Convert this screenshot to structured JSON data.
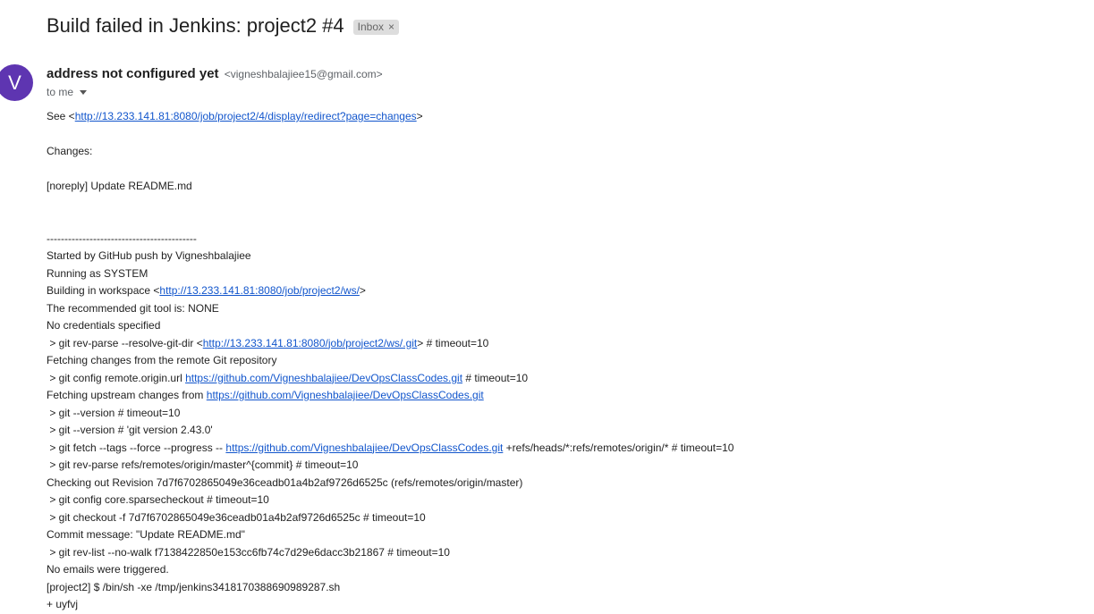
{
  "email": {
    "subject": "Build failed in Jenkins: project2 #4",
    "label": "Inbox",
    "label_close": "×",
    "avatar_letter": "V",
    "sender_name": "address not configured yet",
    "sender_email": "<vigneshbalajiee15@gmail.com>",
    "to": "to me"
  },
  "body_lines": [
    [
      {
        "t": "See <"
      },
      {
        "t": "http://13.233.141.81:8080/job/project2/4/display/redirect?page=changes",
        "link": true
      },
      {
        "t": ">"
      }
    ],
    [],
    [
      {
        "t": "Changes:"
      }
    ],
    [],
    [
      {
        "t": "[noreply] Update README.md"
      }
    ],
    [],
    [],
    [
      {
        "t": "------------------------------------------"
      }
    ],
    [
      {
        "t": "Started by GitHub push by Vigneshbalajiee"
      }
    ],
    [
      {
        "t": "Running as SYSTEM"
      }
    ],
    [
      {
        "t": "Building in workspace <"
      },
      {
        "t": "http://13.233.141.81:8080/job/project2/ws/",
        "link": true
      },
      {
        "t": ">"
      }
    ],
    [
      {
        "t": "The recommended git tool is: NONE"
      }
    ],
    [
      {
        "t": "No credentials specified"
      }
    ],
    [
      {
        "t": " > git rev-parse --resolve-git-dir <"
      },
      {
        "t": "http://13.233.141.81:8080/job/project2/ws/.git",
        "link": true
      },
      {
        "t": "> # timeout=10"
      }
    ],
    [
      {
        "t": "Fetching changes from the remote Git repository"
      }
    ],
    [
      {
        "t": " > git config remote.origin.url "
      },
      {
        "t": "https://github.com/Vigneshbalajiee/DevOpsClassCodes.git",
        "link": true
      },
      {
        "t": " # timeout=10"
      }
    ],
    [
      {
        "t": "Fetching upstream changes from "
      },
      {
        "t": "https://github.com/Vigneshbalajiee/DevOpsClassCodes.git",
        "link": true
      }
    ],
    [
      {
        "t": " > git --version # timeout=10"
      }
    ],
    [
      {
        "t": " > git --version # 'git version 2.43.0'"
      }
    ],
    [
      {
        "t": " > git fetch --tags --force --progress -- "
      },
      {
        "t": "https://github.com/Vigneshbalajiee/DevOpsClassCodes.git",
        "link": true
      },
      {
        "t": " +refs/heads/*:refs/remotes/origin/* # timeout=10"
      }
    ],
    [
      {
        "t": " > git rev-parse refs/remotes/origin/master^{commit} # timeout=10"
      }
    ],
    [
      {
        "t": "Checking out Revision 7d7f6702865049e36ceadb01a4b2af9726d6525c (refs/remotes/origin/master)"
      }
    ],
    [
      {
        "t": " > git config core.sparsecheckout # timeout=10"
      }
    ],
    [
      {
        "t": " > git checkout -f 7d7f6702865049e36ceadb01a4b2af9726d6525c # timeout=10"
      }
    ],
    [
      {
        "t": "Commit message: \"Update README.md\""
      }
    ],
    [
      {
        "t": " > git rev-list --no-walk f7138422850e153cc6fb74c7d29e6dacc3b21867 # timeout=10"
      }
    ],
    [
      {
        "t": "No emails were triggered."
      }
    ],
    [
      {
        "t": "[project2] $ /bin/sh -xe /tmp/jenkins3418170388690989287.sh"
      }
    ],
    [
      {
        "t": "+ uyfvj"
      }
    ]
  ],
  "colors": {
    "avatar": "#5e35b1",
    "link": "#1155cc",
    "chip": "#dddddd"
  }
}
